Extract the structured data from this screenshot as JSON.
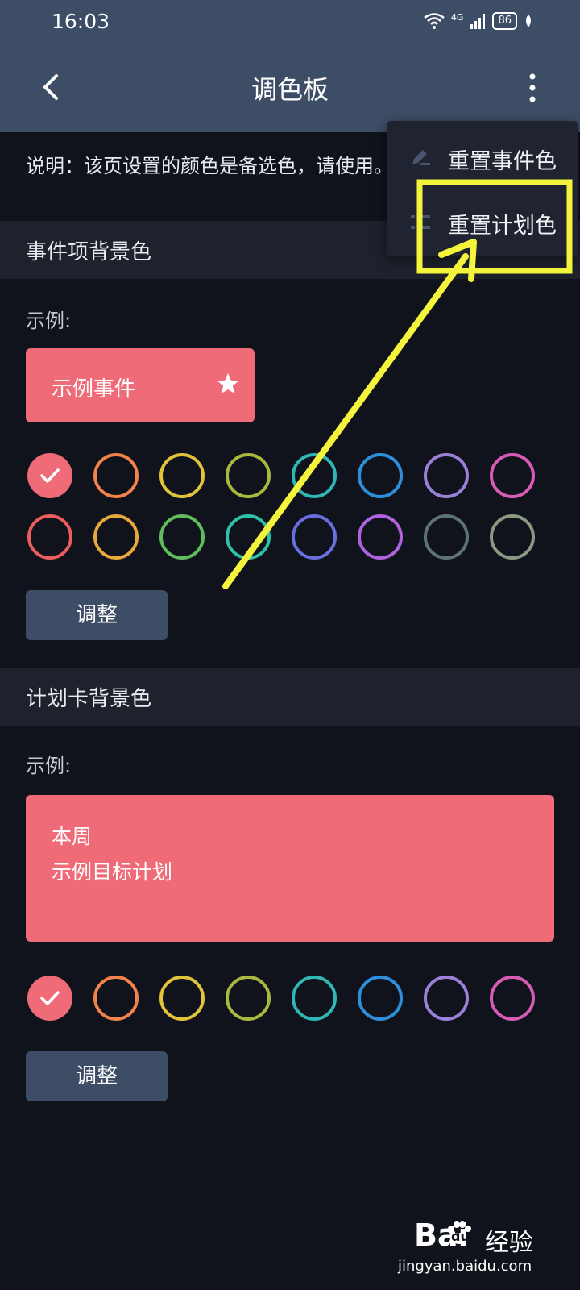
{
  "status_bar": {
    "time": "16:03",
    "network": "4G",
    "battery": "86"
  },
  "app_bar": {
    "title": "调色板"
  },
  "description": "说明：该页设置的颜色是备选色，请使用。",
  "event_section": {
    "header": "事件项背景色",
    "example_label": "示例:",
    "example_text": "示例事件",
    "adjust_label": "调整",
    "swatches_row1": [
      "#f06b78",
      "#f2834a",
      "#e1c43a",
      "#a9b83e",
      "#2fb7b6",
      "#2d8ed9",
      "#9b80d8",
      "#d85cb5"
    ],
    "swatches_row2": [
      "#ec5d5d",
      "#e8a93c",
      "#5fbd5b",
      "#2fc0a8",
      "#6a6fe0",
      "#b163df",
      "#5e7374",
      "#8a9a82"
    ],
    "selected_color": "#f06b78"
  },
  "plan_section": {
    "header": "计划卡背景色",
    "example_label": "示例:",
    "example_line1": "本周",
    "example_line2": "示例目标计划",
    "adjust_label": "调整",
    "swatches": [
      "#f06b78",
      "#f2834a",
      "#e1c43a",
      "#a9b83e",
      "#2fb7b6",
      "#2d8ed9",
      "#9b80d8",
      "#d85cb5"
    ],
    "selected_color": "#f06b78"
  },
  "menu": {
    "items": [
      {
        "label": "重置事件色",
        "icon": "pencil-icon"
      },
      {
        "label": "重置计划色",
        "icon": "list-icon"
      }
    ]
  },
  "annotation": {
    "color": "#f4f43c"
  },
  "watermark": {
    "logo": "Bai",
    "logo_suffix": "du",
    "cn": "经验",
    "url": "jingyan.baidu.com"
  }
}
